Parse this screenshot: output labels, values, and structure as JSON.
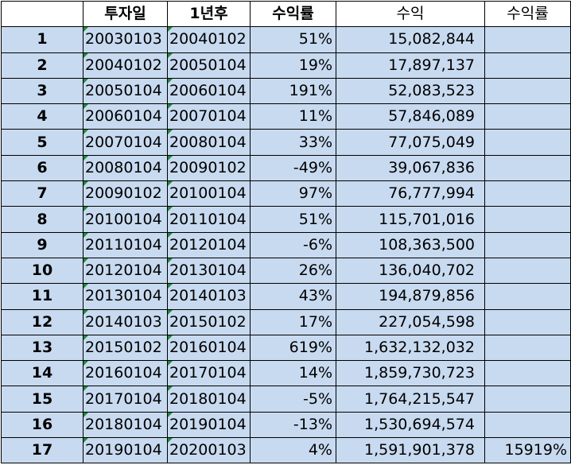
{
  "headers": [
    "",
    "투자일",
    "1년후",
    "수익률",
    "수익",
    "수익률"
  ],
  "rows": [
    {
      "idx": "1",
      "invest_date": "20030103",
      "after_date": "20040102",
      "rate": "51%",
      "profit": "15,082,844",
      "total_rate": ""
    },
    {
      "idx": "2",
      "invest_date": "20040102",
      "after_date": "20050104",
      "rate": "19%",
      "profit": "17,897,137",
      "total_rate": ""
    },
    {
      "idx": "3",
      "invest_date": "20050104",
      "after_date": "20060104",
      "rate": "191%",
      "profit": "52,083,523",
      "total_rate": ""
    },
    {
      "idx": "4",
      "invest_date": "20060104",
      "after_date": "20070104",
      "rate": "11%",
      "profit": "57,846,089",
      "total_rate": ""
    },
    {
      "idx": "5",
      "invest_date": "20070104",
      "after_date": "20080104",
      "rate": "33%",
      "profit": "77,075,049",
      "total_rate": ""
    },
    {
      "idx": "6",
      "invest_date": "20080104",
      "after_date": "20090102",
      "rate": "-49%",
      "profit": "39,067,836",
      "total_rate": ""
    },
    {
      "idx": "7",
      "invest_date": "20090102",
      "after_date": "20100104",
      "rate": "97%",
      "profit": "76,777,994",
      "total_rate": ""
    },
    {
      "idx": "8",
      "invest_date": "20100104",
      "after_date": "20110104",
      "rate": "51%",
      "profit": "115,701,016",
      "total_rate": ""
    },
    {
      "idx": "9",
      "invest_date": "20110104",
      "after_date": "20120104",
      "rate": "-6%",
      "profit": "108,363,500",
      "total_rate": ""
    },
    {
      "idx": "10",
      "invest_date": "20120104",
      "after_date": "20130104",
      "rate": "26%",
      "profit": "136,040,702",
      "total_rate": ""
    },
    {
      "idx": "11",
      "invest_date": "20130104",
      "after_date": "20140103",
      "rate": "43%",
      "profit": "194,879,856",
      "total_rate": ""
    },
    {
      "idx": "12",
      "invest_date": "20140103",
      "after_date": "20150102",
      "rate": "17%",
      "profit": "227,054,598",
      "total_rate": ""
    },
    {
      "idx": "13",
      "invest_date": "20150102",
      "after_date": "20160104",
      "rate": "619%",
      "profit": "1,632,132,032",
      "total_rate": ""
    },
    {
      "idx": "14",
      "invest_date": "20160104",
      "after_date": "20170104",
      "rate": "14%",
      "profit": "1,859,730,723",
      "total_rate": ""
    },
    {
      "idx": "15",
      "invest_date": "20170104",
      "after_date": "20180104",
      "rate": "-5%",
      "profit": "1,764,215,547",
      "total_rate": ""
    },
    {
      "idx": "16",
      "invest_date": "20180104",
      "after_date": "20190104",
      "rate": "-13%",
      "profit": "1,530,694,574",
      "total_rate": ""
    },
    {
      "idx": "17",
      "invest_date": "20190104",
      "after_date": "20200103",
      "rate": "4%",
      "profit": "1,591,901,378",
      "total_rate": "15919%"
    }
  ],
  "colors": {
    "cell_fill": "#c8daf0",
    "border": "#000000",
    "text_marker": "#1f8a3a"
  }
}
